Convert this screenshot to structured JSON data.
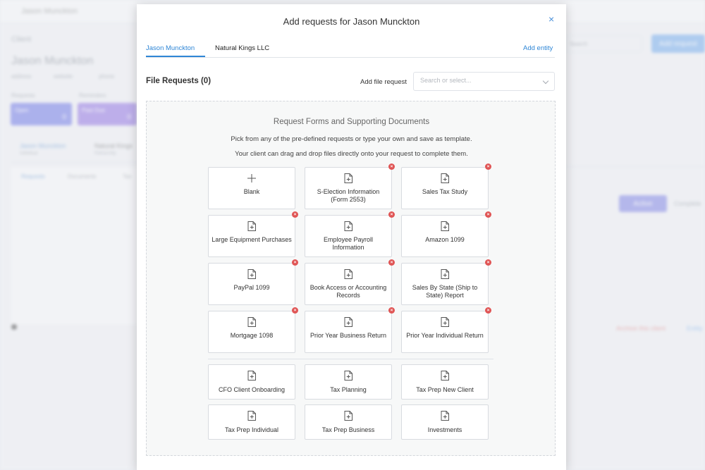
{
  "background": {
    "topbar_label": "Jason Munckton",
    "section_label": "Client",
    "client_name": "Jason Munckton",
    "fields": [
      "address",
      "website",
      "phone"
    ],
    "requests_label": "Requests",
    "reminders_label": "Reminders",
    "cards": [
      {
        "label": "Open",
        "count": "0"
      },
      {
        "label": "Past Due",
        "count": "0"
      }
    ],
    "entities": [
      {
        "name": "Jason Munckton",
        "type": "Individual"
      },
      {
        "name": "Natural Kings",
        "type": "Partnership"
      }
    ],
    "subtabs": [
      "Requests",
      "Documents",
      "Tax"
    ],
    "search_placeholder": "Search",
    "add_request_button": "Add request",
    "active_button": "Active",
    "completed_label": "Complete",
    "archive_link": "Archive this client",
    "entity_link": "Entity"
  },
  "modal": {
    "title": "Add requests for Jason Munckton",
    "close_glyph": "×",
    "tabs": [
      {
        "label": "Jason Munckton",
        "active": true
      },
      {
        "label": "Natural Kings LLC",
        "active": false
      }
    ],
    "add_entity_label": "Add entity",
    "file_requests_title": "File Requests (0)",
    "add_file_request_label": "Add file request",
    "search_placeholder": "Search or select...",
    "drop_zone": {
      "heading": "Request Forms and Supporting Documents",
      "line1": "Pick from any of the pre-defined requests or type your own and save as template.",
      "line2": "Your client can drag and drop files directly onto your request to complete them."
    },
    "requests": [
      {
        "label": "Blank",
        "icon": "plus-icon",
        "deletable": false
      },
      {
        "label": "S-Election Information (Form 2553)",
        "icon": "file-plus-icon",
        "deletable": true
      },
      {
        "label": "Sales Tax Study",
        "icon": "file-plus-icon",
        "deletable": true
      },
      {
        "label": "Large Equipment Purchases",
        "icon": "file-plus-icon",
        "deletable": true
      },
      {
        "label": "Employee Payroll Information",
        "icon": "file-plus-icon",
        "deletable": true
      },
      {
        "label": "Amazon 1099",
        "icon": "file-plus-icon",
        "deletable": true
      },
      {
        "label": "PayPal 1099",
        "icon": "file-plus-icon",
        "deletable": true
      },
      {
        "label": "Book Access or Accounting Records",
        "icon": "file-plus-icon",
        "deletable": true
      },
      {
        "label": "Sales By State (Ship to State) Report",
        "icon": "file-plus-icon",
        "deletable": true
      },
      {
        "label": "Mortgage 1098",
        "icon": "file-plus-icon",
        "deletable": true
      },
      {
        "label": "Prior Year Business Return",
        "icon": "file-plus-icon",
        "deletable": true
      },
      {
        "label": "Prior Year Individual Return",
        "icon": "file-plus-icon",
        "deletable": true
      }
    ],
    "templates": [
      {
        "label": "CFO Client Onboarding",
        "icon": "file-plus-icon"
      },
      {
        "label": "Tax Planning",
        "icon": "file-plus-icon"
      },
      {
        "label": "Tax Prep New Client",
        "icon": "file-plus-icon"
      },
      {
        "label": "Tax Prep Individual",
        "icon": "file-plus-icon"
      },
      {
        "label": "Tax Prep Business",
        "icon": "file-plus-icon"
      },
      {
        "label": "Investments",
        "icon": "file-plus-icon"
      }
    ],
    "delete_glyph": "×"
  },
  "colors": {
    "accent": "#2f86d6",
    "delete": "#e05555",
    "card_open": "#7a82ea",
    "card_past_due": "#9a7ee6",
    "add_request_button": "#7fb3ef",
    "danger_link": "#e58c8c"
  }
}
